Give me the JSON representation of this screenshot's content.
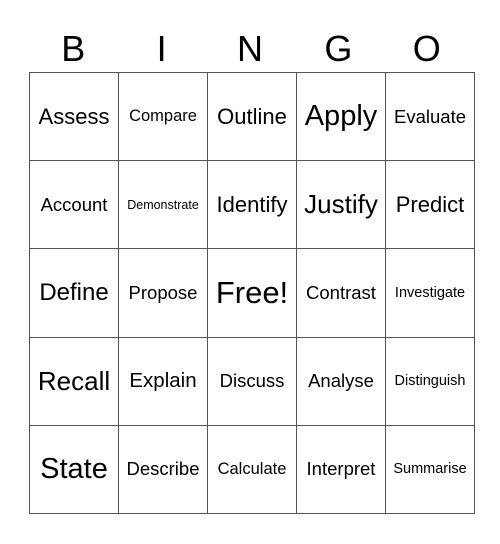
{
  "header": {
    "letters": [
      "B",
      "I",
      "N",
      "G",
      "O"
    ]
  },
  "grid": {
    "rows": [
      [
        "Assess",
        "Compare",
        "Outline",
        "Apply",
        "Evaluate"
      ],
      [
        "Account",
        "Demonstrate",
        "Identify",
        "Justify",
        "Predict"
      ],
      [
        "Define",
        "Propose",
        "Free!",
        "Contrast",
        "Investigate"
      ],
      [
        "Recall",
        "Explain",
        "Discuss",
        "Analyse",
        "Distinguish"
      ],
      [
        "State",
        "Describe",
        "Calculate",
        "Interpret",
        "Summarise"
      ]
    ]
  }
}
